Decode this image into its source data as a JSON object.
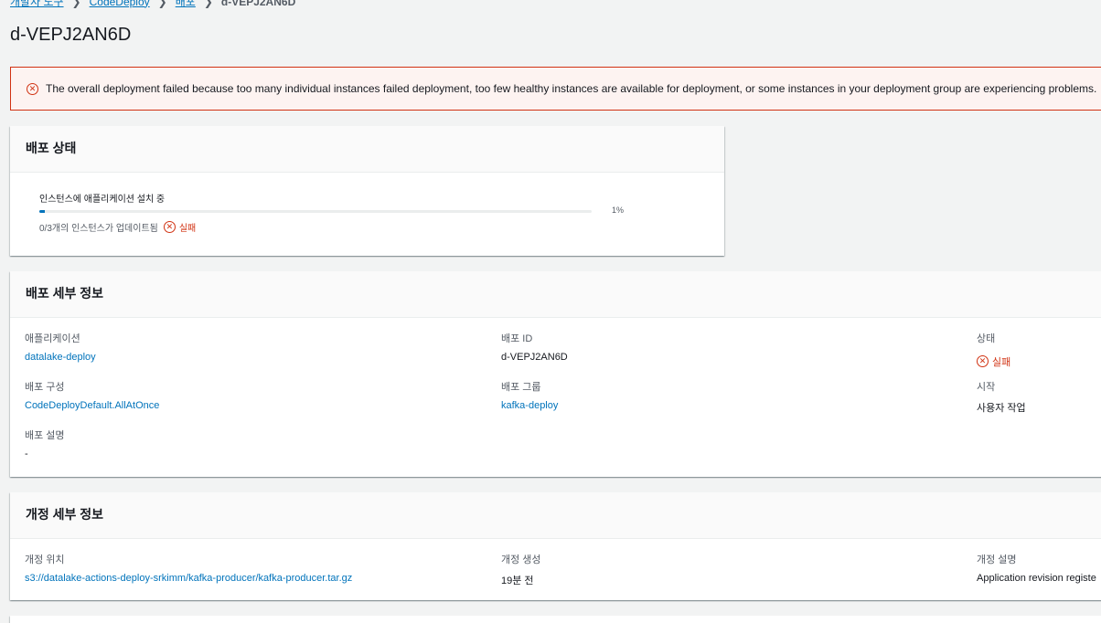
{
  "breadcrumb": {
    "items": [
      "개발자 도구",
      "CodeDeploy",
      "배포"
    ],
    "current": "d-VEPJ2AN6D"
  },
  "page": {
    "title": "d-VEPJ2AN6D"
  },
  "alert": {
    "icon": "error-icon",
    "message": "The overall deployment failed because too many individual instances failed deployment, too few healthy instances are available for deployment, or some instances in your deployment group are experiencing problems."
  },
  "status": {
    "header": "배포 상태",
    "progress_label": "인스턴스에 애플리케이션 설치 중",
    "progress_value": 1,
    "progress_text": "1%",
    "instances_updated": "0/3개의 인스턴스가 업데이트됨",
    "result": "실패"
  },
  "details": {
    "header": "배포 세부 정보",
    "application_label": "애플리케이션",
    "application_value": "datalake-deploy",
    "deployment_id_label": "배포 ID",
    "deployment_id_value": "d-VEPJ2AN6D",
    "status_label": "상태",
    "status_value": "실패",
    "config_label": "배포 구성",
    "config_value": "CodeDeployDefault.AllAtOnce",
    "group_label": "배포 그룹",
    "group_value": "kafka-deploy",
    "start_label": "시작",
    "start_value": "사용자 작업",
    "description_label": "배포 설명",
    "description_value": "-"
  },
  "revision": {
    "header": "개정 세부 정보",
    "location_label": "개정 위치",
    "location_value": "s3://datalake-actions-deploy-srkimm/kafka-producer/kafka-producer.tar.gz",
    "created_label": "개정 생성",
    "created_value": "19분 전",
    "description_label": "개정 설명",
    "description_value": "Application revision registe"
  },
  "colors": {
    "link": "#0073bb",
    "error": "#d13212",
    "background": "#f2f3f3",
    "progress": "#0073bb"
  }
}
